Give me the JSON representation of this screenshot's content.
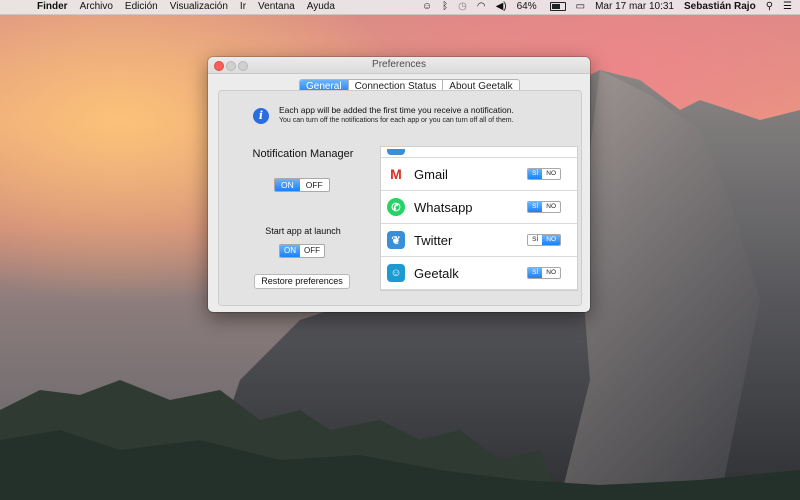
{
  "menubar": {
    "app_name": "Finder",
    "items": [
      "Archivo",
      "Edición",
      "Visualización",
      "Ir",
      "Ventana",
      "Ayuda"
    ],
    "battery": "64%",
    "datetime": "Mar 17 mar  10:31",
    "user": "Sebastián Rajo",
    "icons": [
      "apple-icon",
      "geetalk-status-icon",
      "bluetooth-icon",
      "time-machine-icon",
      "wifi-icon",
      "volume-icon",
      "battery-icon",
      "display-icon",
      "spotlight-icon",
      "notification-center-icon"
    ]
  },
  "window": {
    "title": "Preferences",
    "tabs": [
      {
        "label": "General",
        "active": true
      },
      {
        "label": "Connection Status",
        "active": false
      },
      {
        "label": "About Geetalk",
        "active": false
      }
    ],
    "info": {
      "line1": "Each app will be added the first time you receive a notification.",
      "line2": "You can turn off the notifications for each app or you can turn off all of them."
    },
    "notification_manager": {
      "label": "Notification Manager",
      "on_label": "ON",
      "off_label": "OFF",
      "state": "on"
    },
    "start_at_launch": {
      "label": "Start app at launch",
      "on_label": "ON",
      "off_label": "OFF",
      "state": "on"
    },
    "restore_label": "Restore preferences",
    "apps": [
      {
        "name": "Gmail",
        "icon": "gmail-icon",
        "yes": "SÍ",
        "no": "NO",
        "state": "yes"
      },
      {
        "name": "Whatsapp",
        "icon": "whatsapp-icon",
        "yes": "SÍ",
        "no": "NO",
        "state": "yes"
      },
      {
        "name": "Twitter",
        "icon": "twitter-icon",
        "yes": "SÍ",
        "no": "NO",
        "state": "no"
      },
      {
        "name": "Geetalk",
        "icon": "geetalk-icon",
        "yes": "SÍ",
        "no": "NO",
        "state": "yes"
      }
    ]
  },
  "colors": {
    "accent": "#1a82fb",
    "close": "#fc5f57",
    "gmail": "#d93025",
    "whatsapp": "#25d366",
    "twitter": "#3a8fd9",
    "geetalk": "#1d9bd1"
  }
}
